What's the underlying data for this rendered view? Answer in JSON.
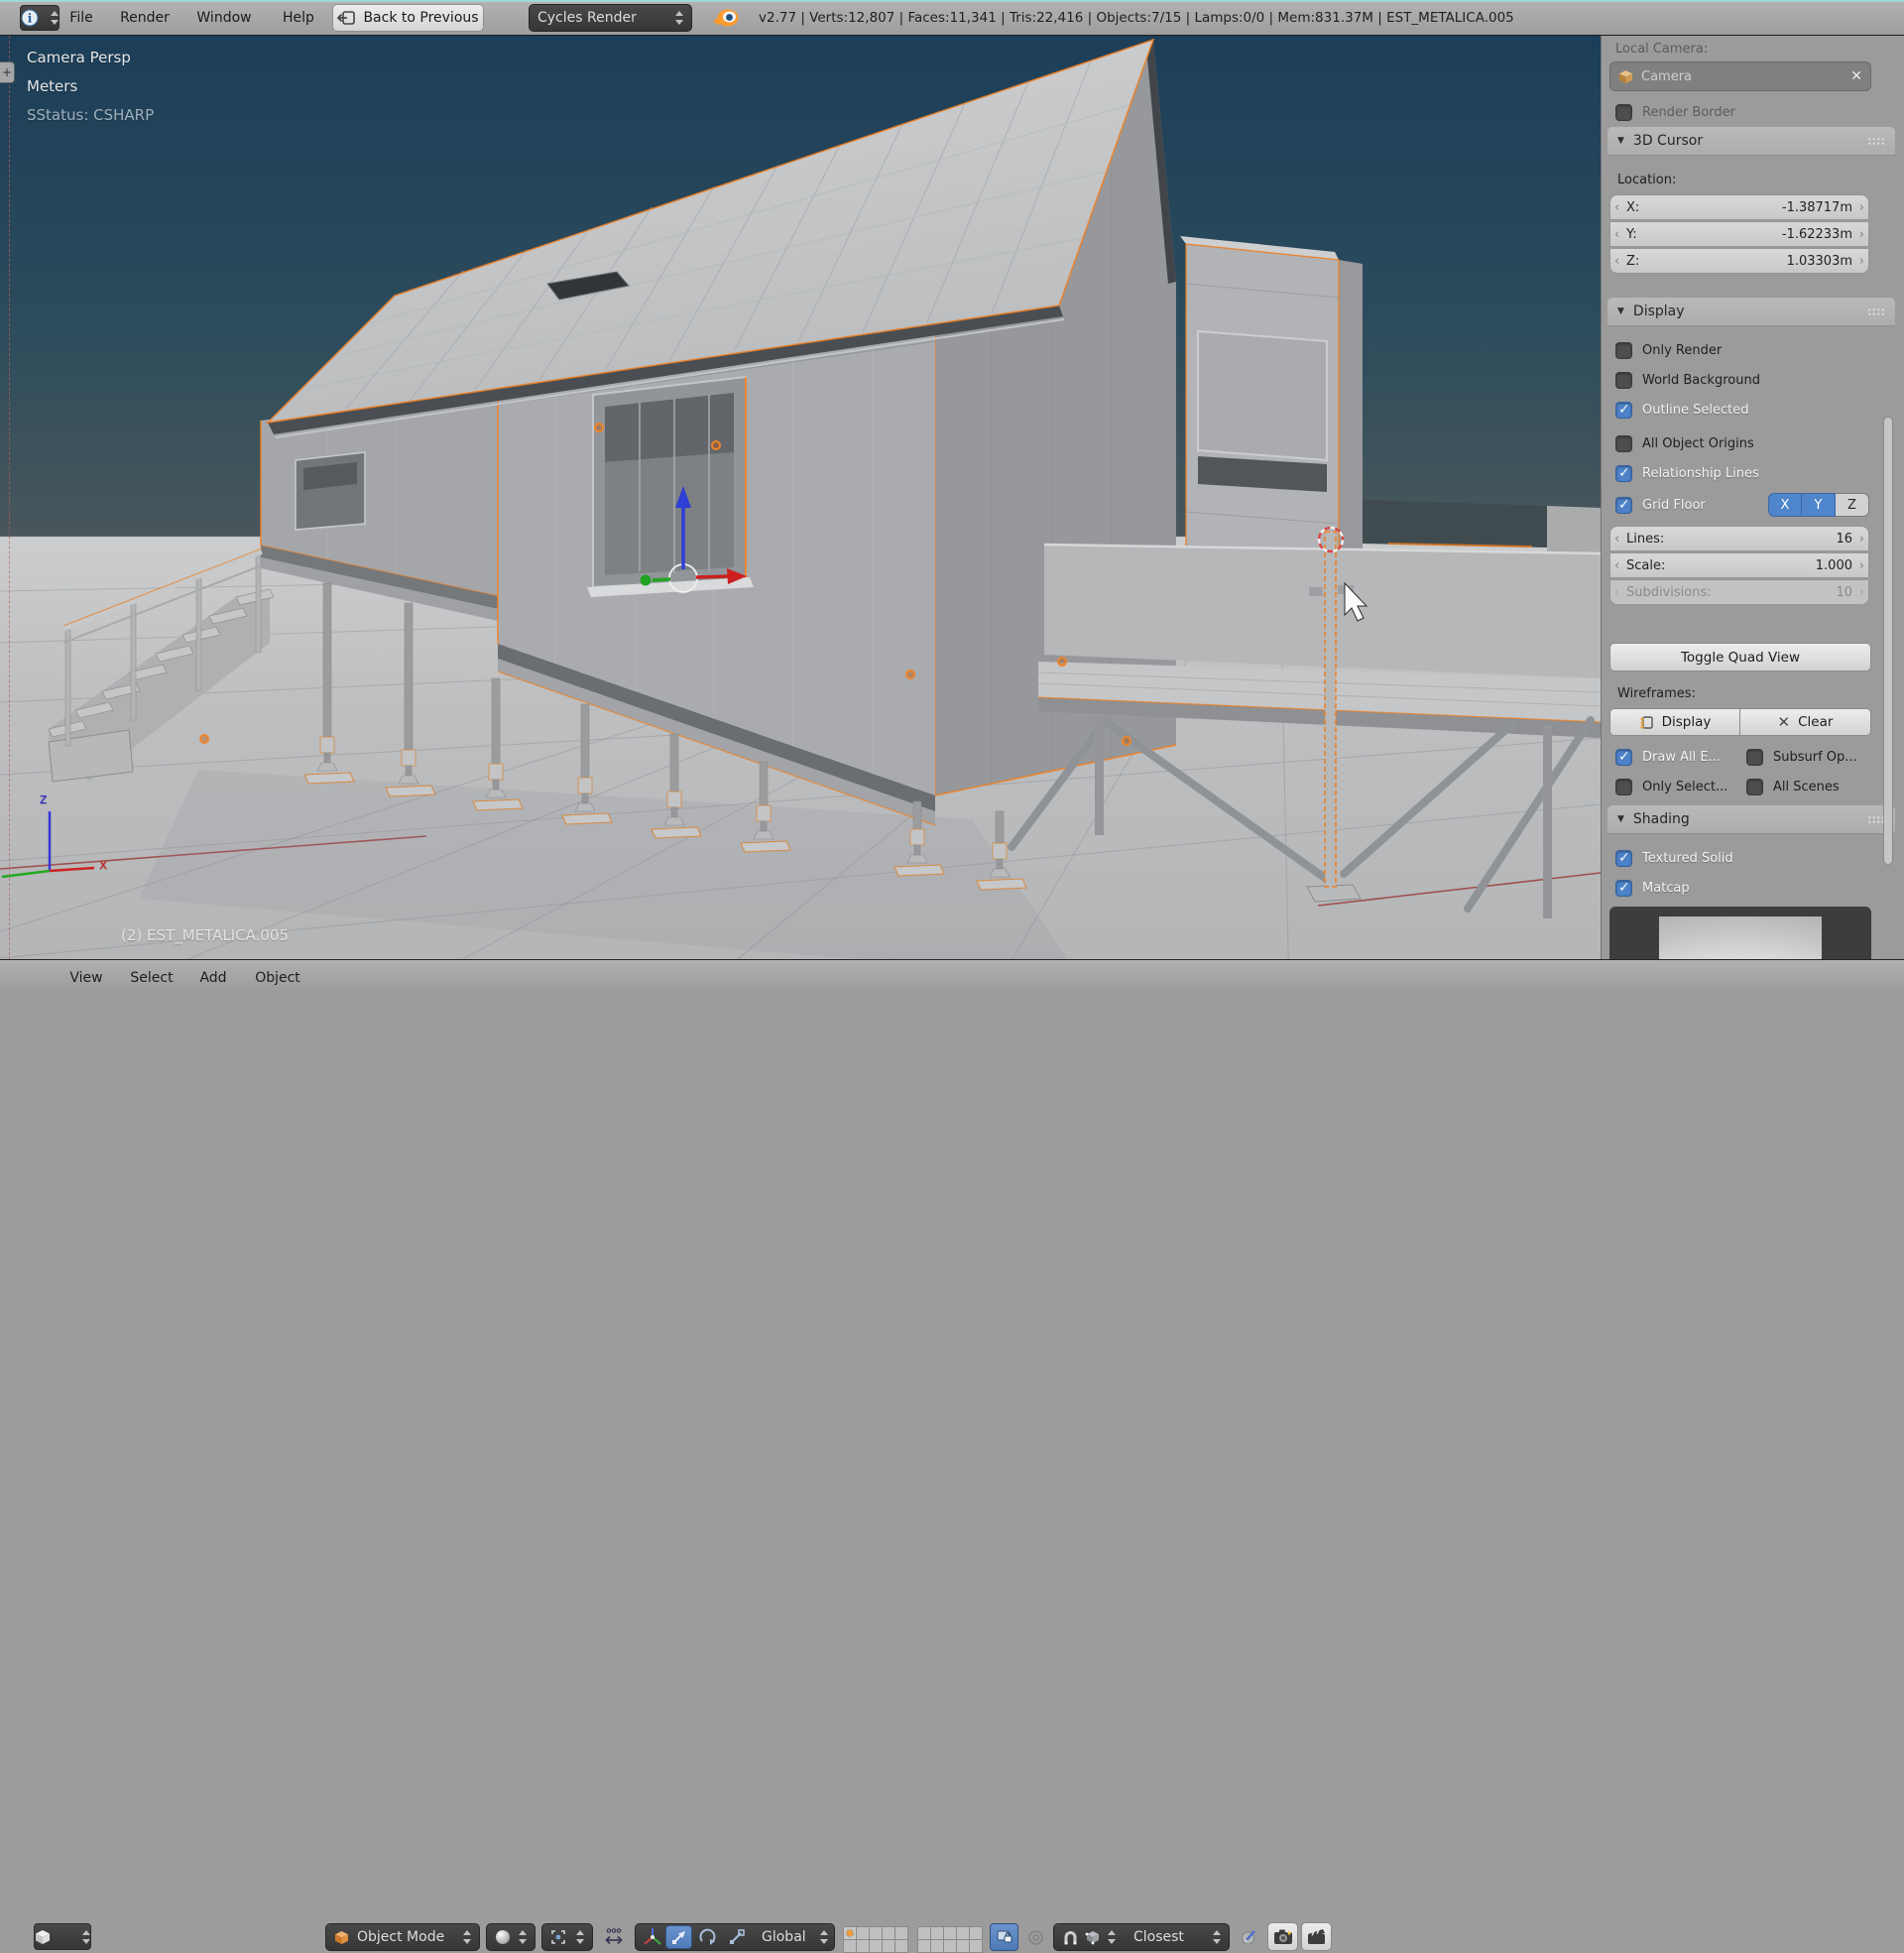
{
  "header": {
    "menus": [
      "File",
      "Render",
      "Window",
      "Help"
    ],
    "back_button_label": "Back to Previous",
    "engine_selector": "Cycles Render",
    "stats_text": "v2.77 | Verts:12,807 | Faces:11,341 | Tris:22,416 | Objects:7/15 | Lamps:0/0 | Mem:831.37M | EST_METALICA.005"
  },
  "viewport": {
    "view_label": "Camera Persp",
    "units_label": "Meters",
    "status_label": "SStatus: CSHARP",
    "object_label": "(2) EST_METALICA.005",
    "axis_x_label": "x",
    "axis_z_label": "z"
  },
  "sidebar": {
    "local_camera_label": "Local Camera:",
    "camera_field_value": "Camera",
    "render_border_label": "Render Border",
    "cursor_panel": {
      "title": "3D Cursor",
      "location_label": "Location:",
      "fields": [
        {
          "label": "X:",
          "value": "-1.38717m"
        },
        {
          "label": "Y:",
          "value": "-1.62233m"
        },
        {
          "label": "Z:",
          "value": "1.03303m"
        }
      ]
    },
    "display_panel": {
      "title": "Display",
      "checkboxes": [
        {
          "label": "Only Render",
          "checked": false
        },
        {
          "label": "World Background",
          "checked": false
        },
        {
          "label": "Outline Selected",
          "checked": true
        },
        {
          "label": "All Object Origins",
          "checked": false
        },
        {
          "label": "Relationship Lines",
          "checked": true
        },
        {
          "label": "Grid Floor",
          "checked": true
        }
      ],
      "grid_axes": [
        {
          "label": "X",
          "active": true
        },
        {
          "label": "Y",
          "active": true
        },
        {
          "label": "Z",
          "active": false
        }
      ],
      "number_fields": [
        {
          "label": "Lines:",
          "value": "16",
          "disabled": false
        },
        {
          "label": "Scale:",
          "value": "1.000",
          "disabled": false
        },
        {
          "label": "Subdivisions:",
          "value": "10",
          "disabled": true
        }
      ],
      "toggle_quad_view_label": "Toggle Quad View",
      "wireframes_label": "Wireframes:",
      "wireframe_display_label": "Display",
      "wireframe_clear_label": "Clear",
      "wire_checkboxes": [
        {
          "label": "Draw All E...",
          "checked": true
        },
        {
          "label": "Subsurf Op...",
          "checked": false
        },
        {
          "label": "Only Select...",
          "checked": false
        },
        {
          "label": "All Scenes",
          "checked": false
        }
      ]
    },
    "shading_panel": {
      "title": "Shading",
      "checkboxes": [
        {
          "label": "Textured Solid",
          "checked": true
        },
        {
          "label": "Matcap",
          "checked": true
        }
      ]
    }
  },
  "footer": {
    "menus": [
      "View",
      "Select",
      "Add",
      "Object"
    ],
    "mode_selector": "Object Mode",
    "orientation_selector": "Global",
    "snap_selector": "Closest"
  },
  "colors": {
    "accent_orange": "#f08428",
    "selection_blue": "#4d82c8",
    "sky_top": "#1c3e58",
    "ground": "#b8babc"
  }
}
